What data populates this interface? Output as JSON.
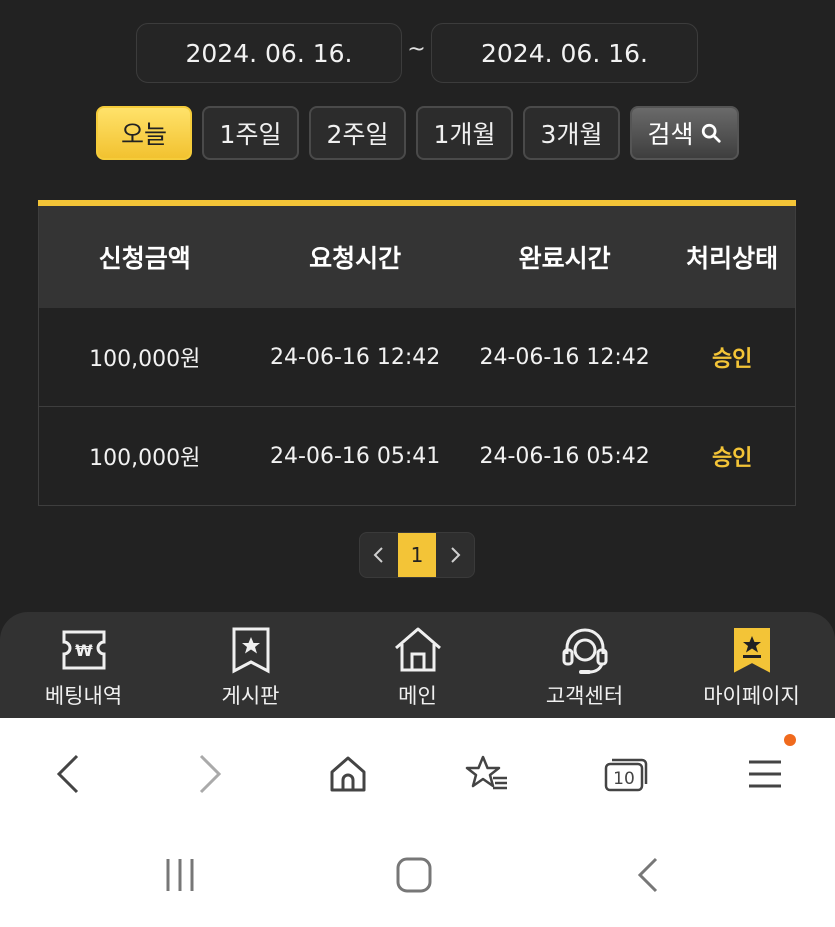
{
  "date_range": {
    "from": "2024. 06. 16.",
    "separator": "~",
    "to": "2024. 06. 16."
  },
  "periods": [
    {
      "label": "오늘",
      "active": true
    },
    {
      "label": "1주일",
      "active": false
    },
    {
      "label": "2주일",
      "active": false
    },
    {
      "label": "1개월",
      "active": false
    },
    {
      "label": "3개월",
      "active": false
    }
  ],
  "search_label": "검색",
  "table": {
    "headers": [
      "신청금액",
      "요청시간",
      "완료시간",
      "처리상태"
    ],
    "rows": [
      {
        "amount": "100,000원",
        "requested": "24-06-16 12:42",
        "completed": "24-06-16 12:42",
        "status": "승인"
      },
      {
        "amount": "100,000원",
        "requested": "24-06-16 05:41",
        "completed": "24-06-16 05:42",
        "status": "승인"
      }
    ]
  },
  "pagination": {
    "current": "1"
  },
  "site_nav": [
    {
      "label": "베팅내역",
      "icon": "ticket-won-icon"
    },
    {
      "label": "게시판",
      "icon": "board-star-icon"
    },
    {
      "label": "메인",
      "icon": "home-icon"
    },
    {
      "label": "고객센터",
      "icon": "headset-icon"
    },
    {
      "label": "마이페이지",
      "icon": "bookmark-star-icon",
      "active": true
    }
  ],
  "browser": {
    "tabs_count": "10"
  },
  "colors": {
    "accent": "#f3c437",
    "background": "#222222",
    "notification": "#f06a1d"
  }
}
